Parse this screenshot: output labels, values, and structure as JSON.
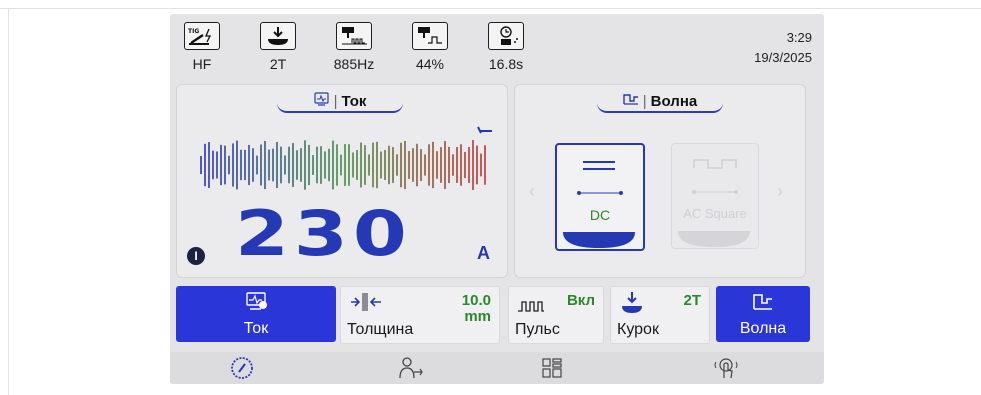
{
  "status": {
    "items": [
      {
        "icon": "tig-hf-icon",
        "value": "HF"
      },
      {
        "icon": "trigger-mode-icon",
        "value": "2T"
      },
      {
        "icon": "pulse-frequency-icon",
        "value": "885Hz"
      },
      {
        "icon": "pulse-duty-icon",
        "value": "44%"
      },
      {
        "icon": "post-gas-timer-icon",
        "value": "16.8s"
      }
    ],
    "time": "3:29",
    "date": "19/3/2025"
  },
  "current_panel": {
    "title": "Ток",
    "value": "230",
    "unit": "A",
    "marker": "I"
  },
  "wave_panel": {
    "title": "Волна",
    "options": [
      {
        "label": "DC",
        "selected": true
      },
      {
        "label": "AC Square",
        "selected": false
      }
    ]
  },
  "functions": {
    "current": {
      "label": "Ток"
    },
    "thickness": {
      "label": "Толщина",
      "value": "10.0",
      "unit": "mm"
    },
    "pulse": {
      "label": "Пульс",
      "value": "Вкл"
    },
    "trigger": {
      "label": "Курок",
      "value": "2T"
    },
    "wave": {
      "label": "Волна"
    }
  },
  "nav": [
    "gauge-icon",
    "welder-icon",
    "menu-grid-icon",
    "touch-icon"
  ],
  "colors": {
    "accent": "#2539b5",
    "button_active": "#2a36d8",
    "value_green": "#2a8a2a"
  }
}
